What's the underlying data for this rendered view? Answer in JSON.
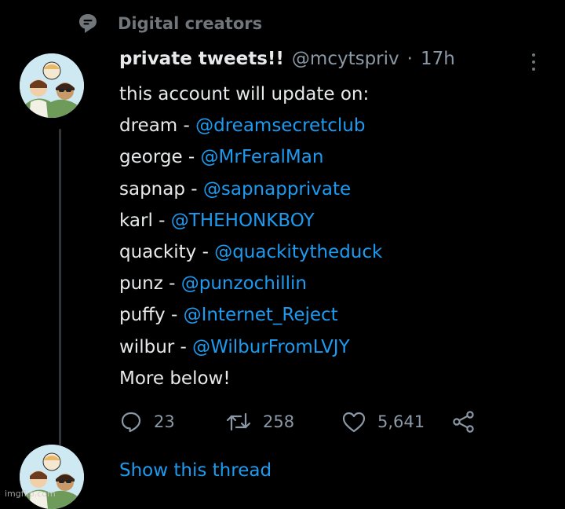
{
  "social_context": {
    "label": "Digital creators",
    "icon": "topic-icon"
  },
  "tweet": {
    "display_name": "private tweets!!",
    "handle": "@mcytspriv",
    "separator": "·",
    "timestamp": "17h",
    "intro": "this account will update on:",
    "lines": [
      {
        "name": "dream - ",
        "mention": "@dreamsecretclub"
      },
      {
        "name": "george - ",
        "mention": "@MrFeralMan"
      },
      {
        "name": "sapnap - ",
        "mention": "@sapnapprivate"
      },
      {
        "name": "karl - ",
        "mention": "@THEHONKBOY"
      },
      {
        "name": "quackity - ",
        "mention": "@quackitytheduck"
      },
      {
        "name": "punz - ",
        "mention": "@punzochillin"
      },
      {
        "name": "puffy - ",
        "mention": "@Internet_Reject"
      },
      {
        "name": "wilbur - ",
        "mention": "@WilburFromLVJY"
      }
    ],
    "outro": "More below!",
    "actions": {
      "replies": "23",
      "retweets": "258",
      "likes": "5,641"
    }
  },
  "thread": {
    "show_label": "Show this thread"
  },
  "watermark": "imgflip.com",
  "colors": {
    "background": "#000000",
    "text": "#e7e9ea",
    "secondary": "#8b98a5",
    "link": "#1d9bf0"
  }
}
